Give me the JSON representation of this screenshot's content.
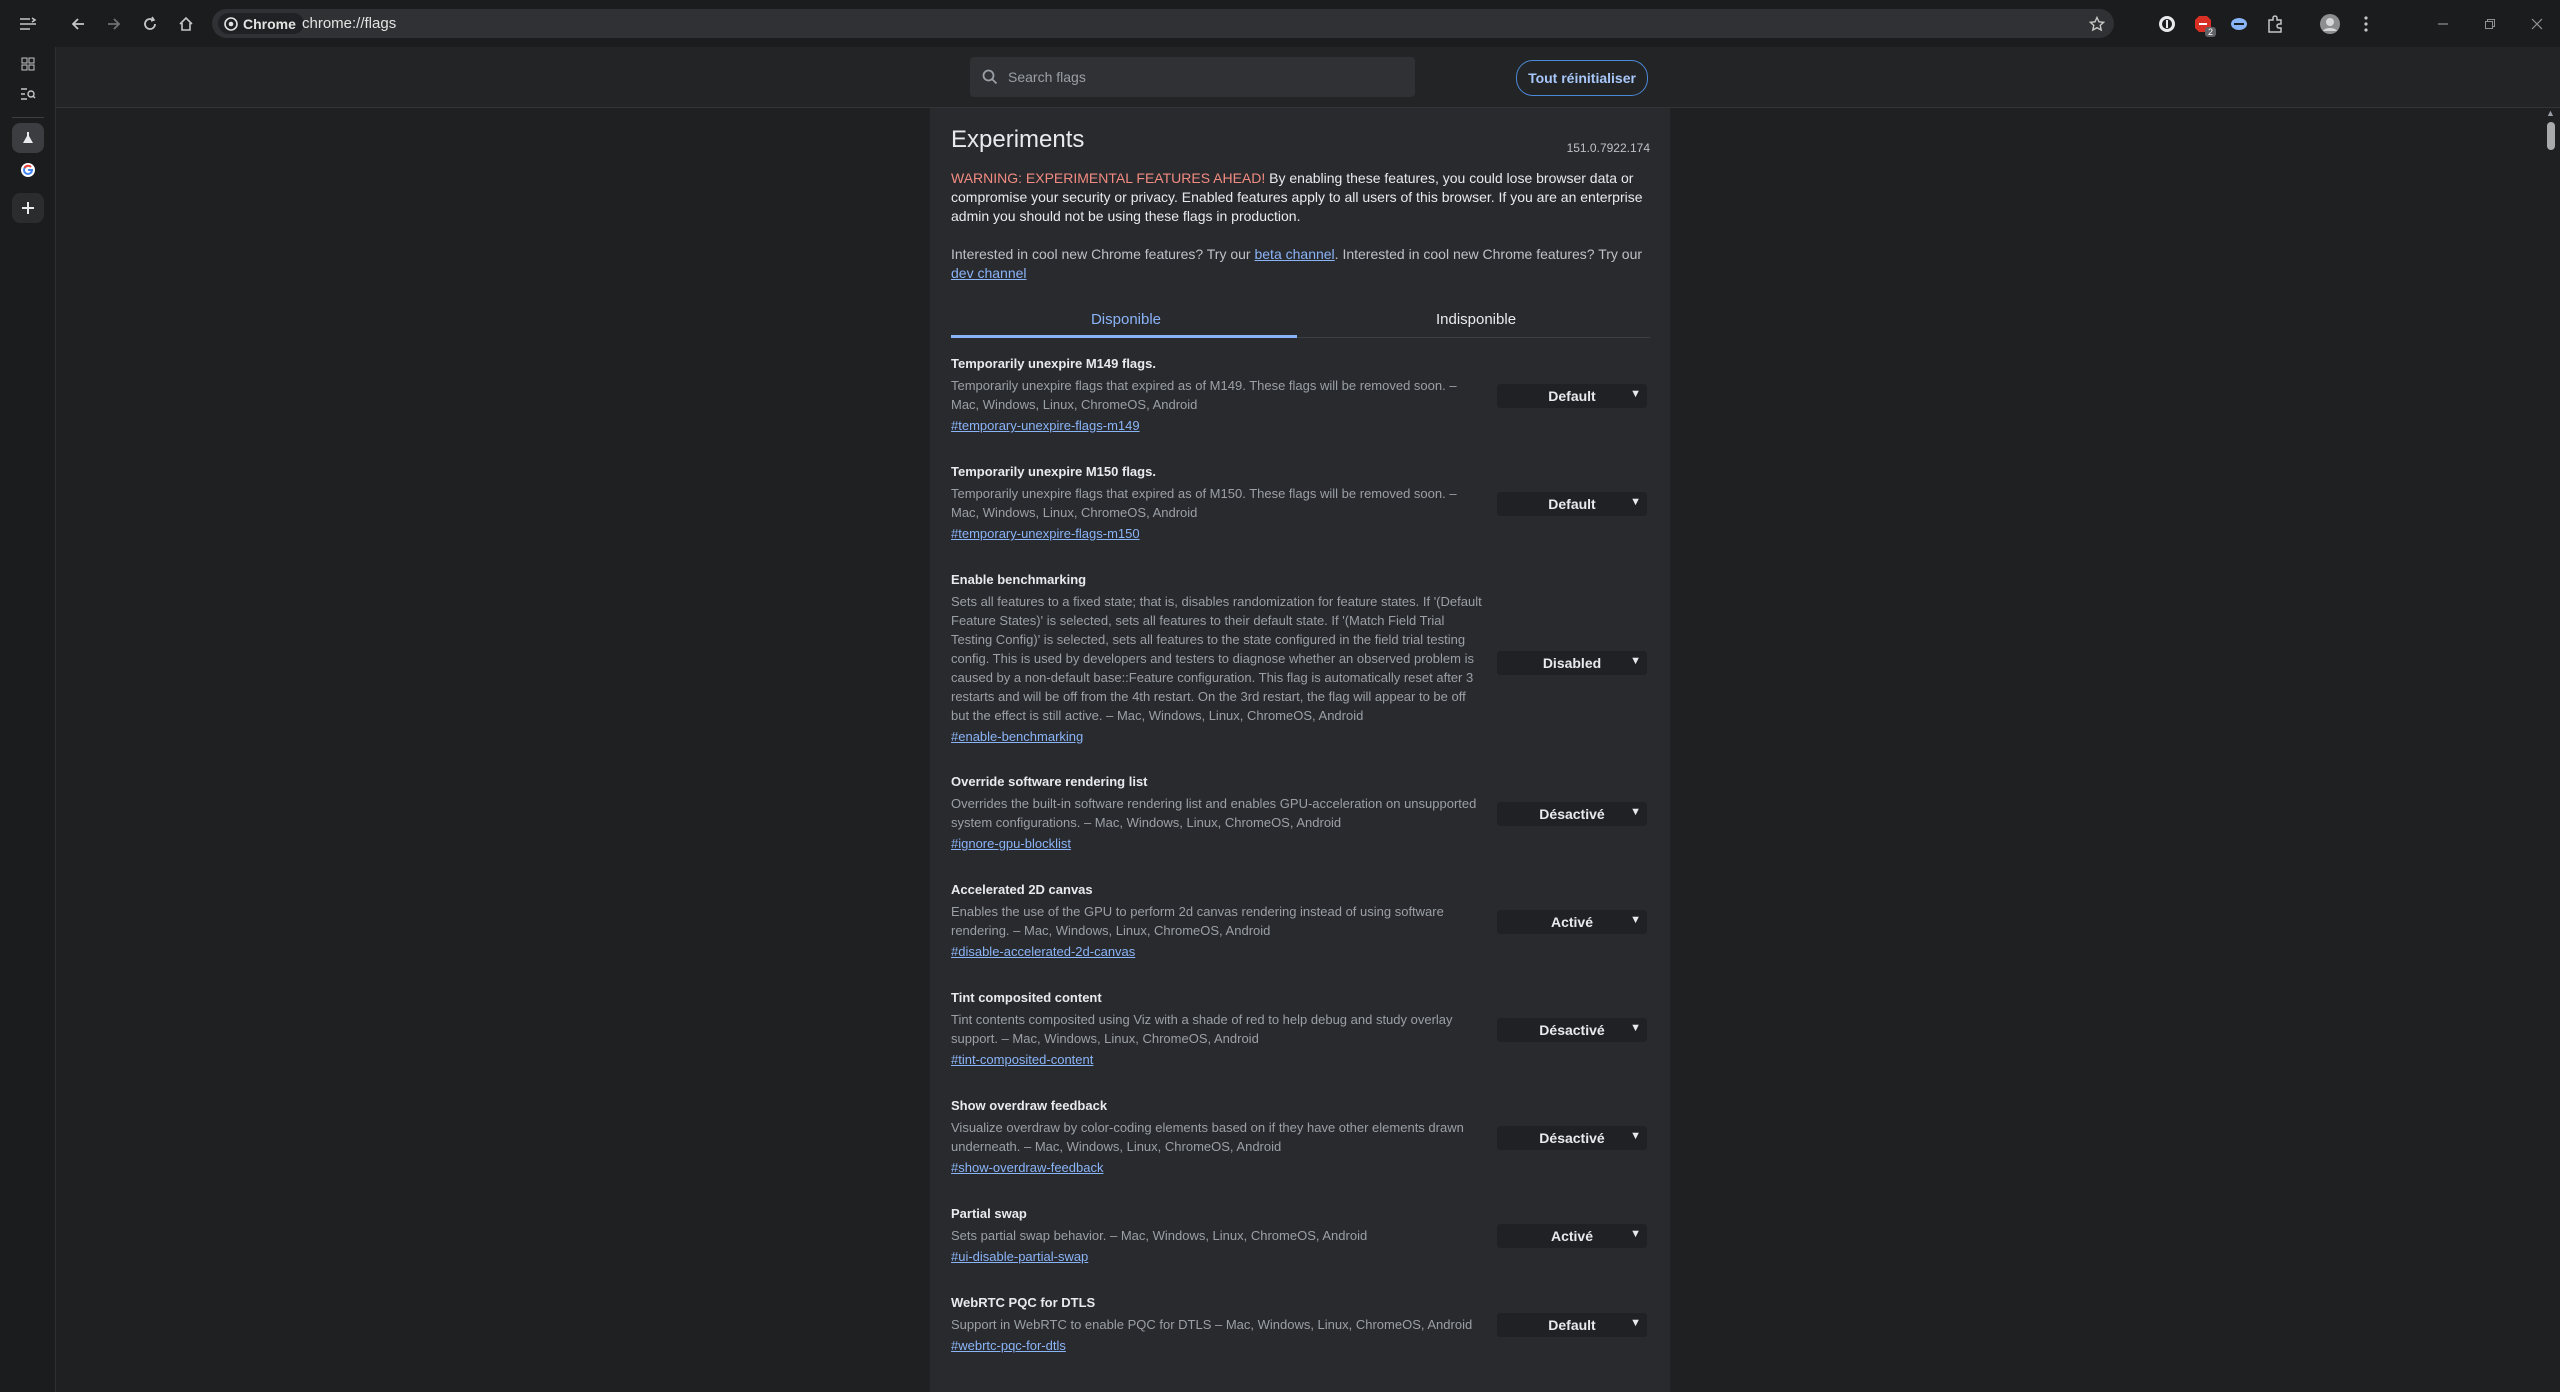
{
  "browser": {
    "chip_label": "Chrome",
    "url": "chrome://flags",
    "extension_badge": "2"
  },
  "topbar": {
    "search_placeholder": "Search flags",
    "reset_label": "Tout réinitialiser"
  },
  "page": {
    "title": "Experiments",
    "version": "151.0.7922.174",
    "warning_prefix": "WARNING: EXPERIMENTAL FEATURES AHEAD!",
    "warning_text": " By enabling these features, you could lose browser data or compromise your security or privacy. Enabled features apply to all users of this browser. If you are an enterprise admin you should not be using these flags in production.",
    "interest_1": "Interested in cool new Chrome features? Try our ",
    "beta_link": "beta channel",
    "interest_2": ". Interested in cool new Chrome features? Try our ",
    "dev_link": "dev channel",
    "tab_available": "Disponible",
    "tab_unavailable": "Indisponible"
  },
  "flags": [
    {
      "title": "Temporarily unexpire M149 flags.",
      "description": "Temporarily unexpire flags that expired as of M149. These flags will be removed soon. – Mac, Windows, Linux, ChromeOS, Android",
      "link": "#temporary-unexpire-flags-m149",
      "value": "Default"
    },
    {
      "title": "Temporarily unexpire M150 flags.",
      "description": "Temporarily unexpire flags that expired as of M150. These flags will be removed soon. – Mac, Windows, Linux, ChromeOS, Android",
      "link": "#temporary-unexpire-flags-m150",
      "value": "Default"
    },
    {
      "title": "Enable benchmarking",
      "description": "Sets all features to a fixed state; that is, disables randomization for feature states. If '(Default Feature States)' is selected, sets all features to their default state. If '(Match Field Trial Testing Config)' is selected, sets all features to the state configured in the field trial testing config. This is used by developers and testers to diagnose whether an observed problem is caused by a non-default base::Feature configuration. This flag is automatically reset after 3 restarts and will be off from the 4th restart. On the 3rd restart, the flag will appear to be off but the effect is still active. – Mac, Windows, Linux, ChromeOS, Android",
      "link": "#enable-benchmarking",
      "value": "Disabled"
    },
    {
      "title": "Override software rendering list",
      "description": "Overrides the built-in software rendering list and enables GPU-acceleration on unsupported system configurations. – Mac, Windows, Linux, ChromeOS, Android",
      "link": "#ignore-gpu-blocklist",
      "value": "Désactivé"
    },
    {
      "title": "Accelerated 2D canvas",
      "description": "Enables the use of the GPU to perform 2d canvas rendering instead of using software rendering. – Mac, Windows, Linux, ChromeOS, Android",
      "link": "#disable-accelerated-2d-canvas",
      "value": "Activé"
    },
    {
      "title": "Tint composited content",
      "description": "Tint contents composited using Viz with a shade of red to help debug and study overlay support. – Mac, Windows, Linux, ChromeOS, Android",
      "link": "#tint-composited-content",
      "value": "Désactivé"
    },
    {
      "title": "Show overdraw feedback",
      "description": "Visualize overdraw by color-coding elements based on if they have other elements drawn underneath. – Mac, Windows, Linux, ChromeOS, Android",
      "link": "#show-overdraw-feedback",
      "value": "Désactivé"
    },
    {
      "title": "Partial swap",
      "description": "Sets partial swap behavior. – Mac, Windows, Linux, ChromeOS, Android",
      "link": "#ui-disable-partial-swap",
      "value": "Activé"
    },
    {
      "title": "WebRTC PQC for DTLS",
      "description": "Support in WebRTC to enable PQC for DTLS – Mac, Windows, Linux, ChromeOS, Android",
      "link": "#webrtc-pqc-for-dtls",
      "value": "Default"
    }
  ]
}
